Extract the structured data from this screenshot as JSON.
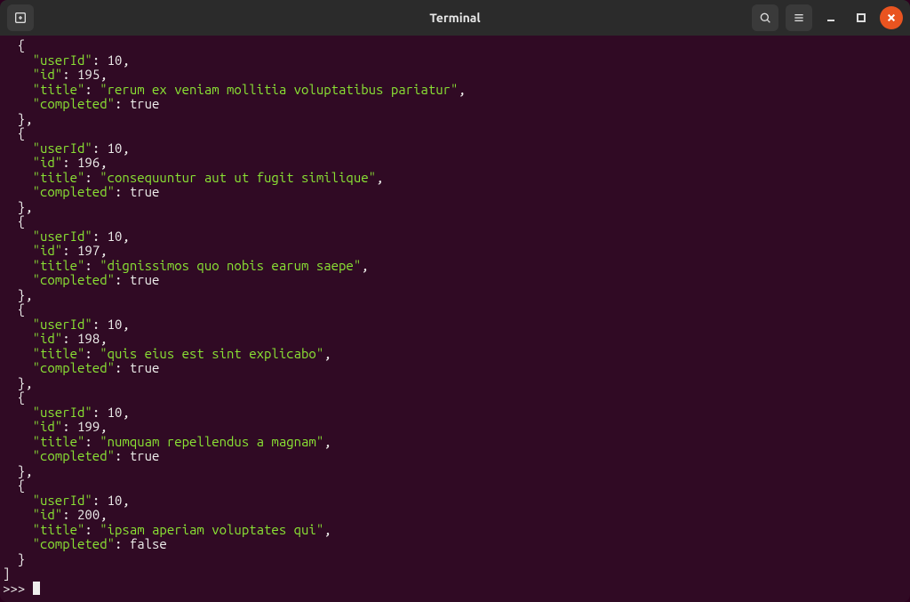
{
  "window": {
    "title": "Terminal"
  },
  "icons": {
    "new_tab": "new-tab-icon",
    "search": "search-icon",
    "menu": "hamburger-icon",
    "minimize": "minimize-icon",
    "maximize": "maximize-icon",
    "close": "close-icon"
  },
  "prompt": ">>> ",
  "bracket_line": "]",
  "field_labels": {
    "userId": "userId",
    "id": "id",
    "title": "title",
    "completed": "completed"
  },
  "records": [
    {
      "userId": 10,
      "id": 195,
      "title": "rerum ex veniam mollitia voluptatibus pariatur",
      "completed": true
    },
    {
      "userId": 10,
      "id": 196,
      "title": "consequuntur aut ut fugit similique",
      "completed": true
    },
    {
      "userId": 10,
      "id": 197,
      "title": "dignissimos quo nobis earum saepe",
      "completed": true
    },
    {
      "userId": 10,
      "id": 198,
      "title": "quis eius est sint explicabo",
      "completed": true
    },
    {
      "userId": 10,
      "id": 199,
      "title": "numquam repellendus a magnam",
      "completed": true
    },
    {
      "userId": 10,
      "id": 200,
      "title": "ipsam aperiam voluptates qui",
      "completed": false
    }
  ]
}
